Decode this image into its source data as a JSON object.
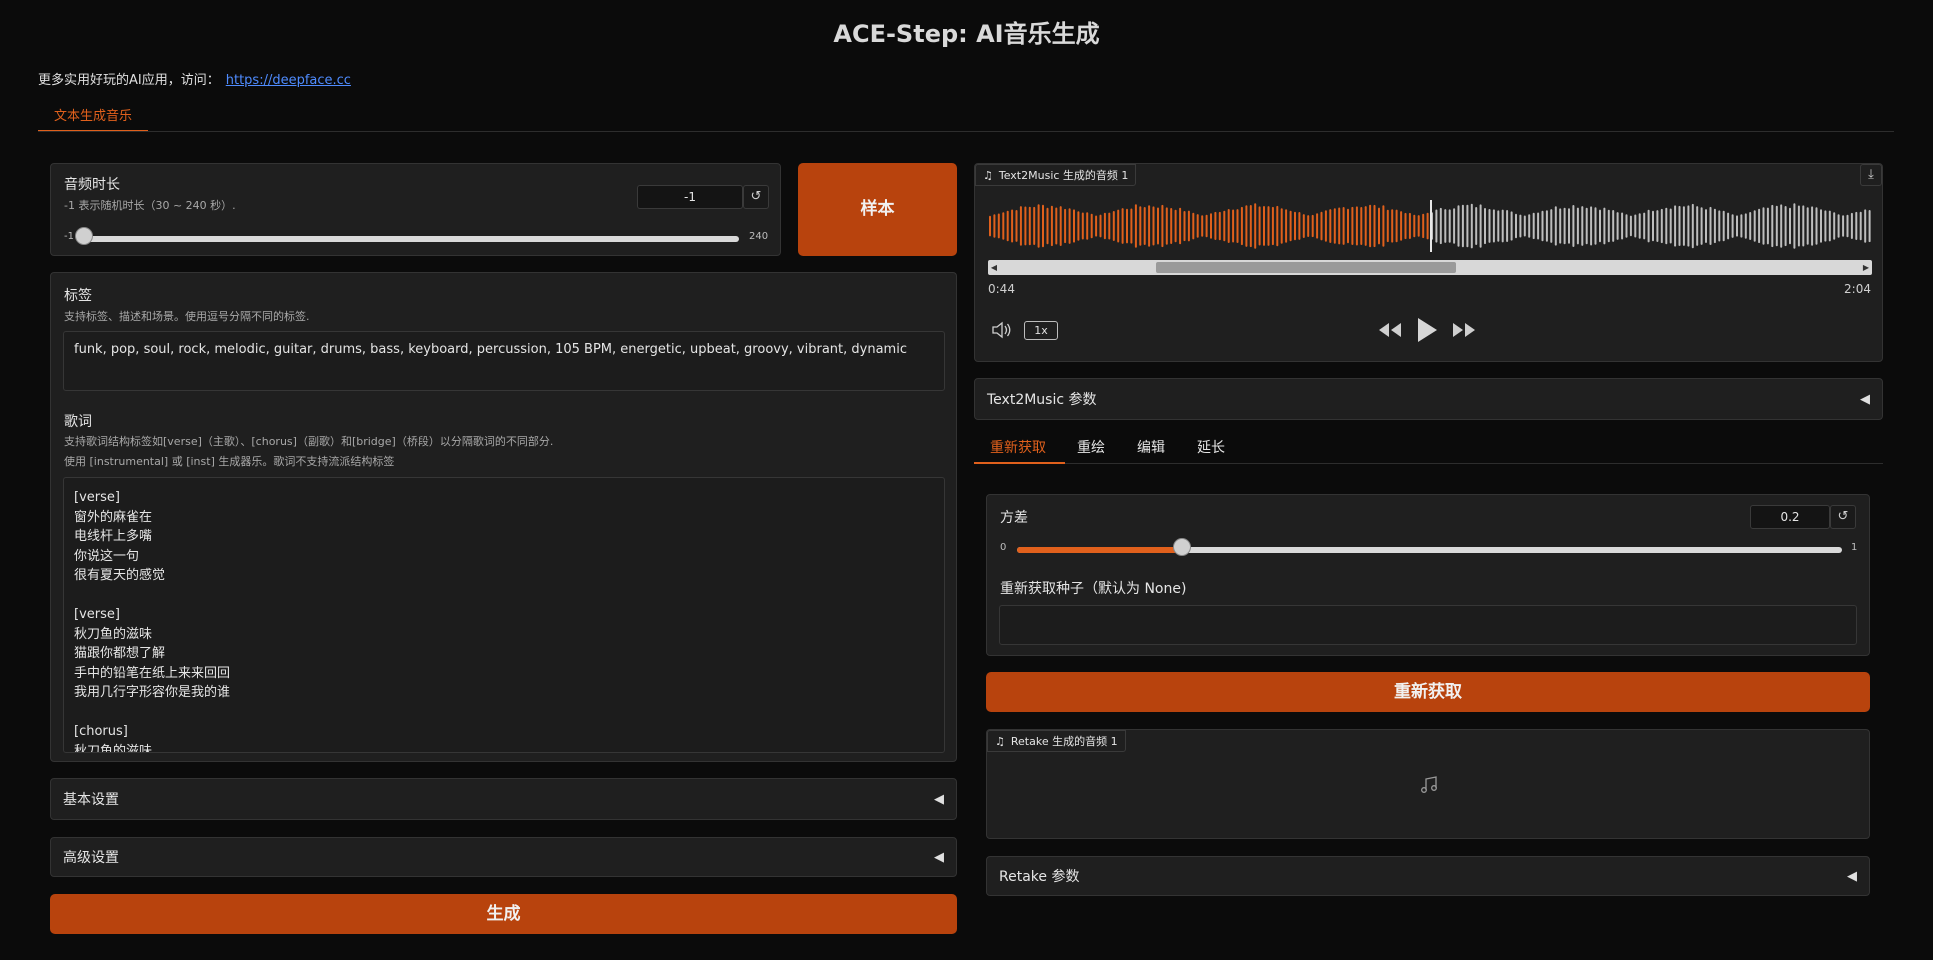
{
  "header": {
    "title": "ACE-Step: AI音乐生成",
    "promo_text": "更多实用好玩的AI应用，访问：",
    "promo_link": "https://deepface.cc"
  },
  "tabs": {
    "main_tab": "文本生成音乐"
  },
  "left": {
    "duration": {
      "label": "音频时长",
      "hint": "-1 表示随机时长（30 ~ 240 秒）.",
      "value": "-1",
      "reset_icon": "↺",
      "min": "-1",
      "max": "240",
      "level": 0.0
    },
    "sample_button": "样本",
    "tags": {
      "label": "标签",
      "hint": "支持标签、描述和场景。使用逗号分隔不同的标签.",
      "value": "funk, pop, soul, rock, melodic, guitar, drums, bass, keyboard, percussion, 105 BPM, energetic, upbeat, groovy, vibrant, dynamic"
    },
    "lyrics": {
      "label": "歌词",
      "hint1": "支持歌词结构标签如[verse]（主歌）、[chorus]（副歌）和[bridge]（桥段）以分隔歌词的不同部分.",
      "hint2": "使用 [instrumental] 或 [inst] 生成器乐。歌词不支持流派结构标签",
      "lines": [
        "[verse]",
        "窗外的麻雀在",
        "电线杆上多嘴",
        "你说这一句",
        "很有夏天的感觉",
        "",
        "[verse]",
        "秋刀鱼的滋味",
        "猫跟你都想了解",
        "手中的铅笔在纸上来来回回",
        "我用几行字形容你是我的谁",
        "",
        "[chorus]",
        "秋刀鱼的滋味"
      ]
    },
    "basic_settings": "基本设置",
    "advanced_settings": "高级设置",
    "accordion_icon": "◀",
    "generate_button": "生成"
  },
  "right": {
    "audio1": {
      "chip_label": "Text2Music 生成的音频 1",
      "current_time": "0:44",
      "total_time": "2:04",
      "speed": "1x",
      "progress": 0.5,
      "icons": {
        "note": "♫",
        "download": "⤓",
        "volume": "volume-icon",
        "rewind": "rewind-icon",
        "play": "play-icon",
        "forward": "forward-icon"
      }
    },
    "t2m_params": "Text2Music 参数",
    "subtabs": [
      "重新获取",
      "重绘",
      "编辑",
      "延长"
    ],
    "variance": {
      "label": "方差",
      "value": "0.2",
      "min": "0",
      "max": "1",
      "level": 0.2
    },
    "seed": {
      "label": "重新获取种子（默认为 None)",
      "value": ""
    },
    "retake_button": "重新获取",
    "retake_audio": {
      "chip_label": "Retake 生成的音频 1"
    },
    "retake_params": "Retake 参数"
  },
  "colors": {
    "accent": "#e0601c",
    "button": "#b8430d",
    "background": "#0b0b0b",
    "panel": "#1f1f1f"
  }
}
